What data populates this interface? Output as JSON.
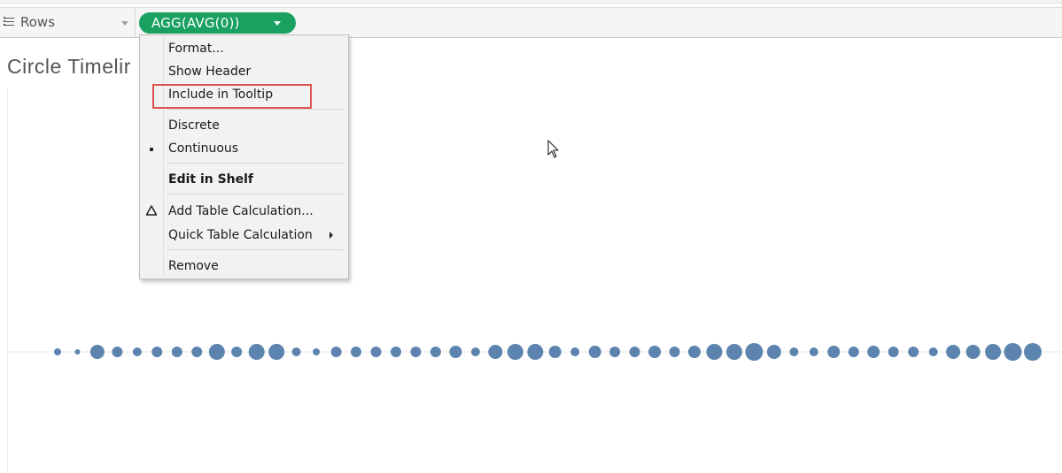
{
  "shelf": {
    "label": "Rows",
    "rows_icon": "list-icon",
    "dropdown_icon": "chevron-down-icon"
  },
  "pill": {
    "label": "AGG(AVG(0))",
    "color": "#1aa162",
    "dropdown_icon": "chevron-down-icon"
  },
  "view": {
    "title": "Circle Timelir"
  },
  "menu": {
    "items": [
      {
        "label": "Format..."
      },
      {
        "label": "Show Header"
      },
      {
        "label": "Include in Tooltip",
        "highlighted": true
      },
      {
        "label": "Discrete"
      },
      {
        "label": "Continuous",
        "selected": true
      },
      {
        "label": "Edit in Shelf",
        "bold": true
      },
      {
        "label": "Add Table Calculation...",
        "icon": "delta-icon"
      },
      {
        "label": "Quick Table Calculation",
        "submenu": true
      },
      {
        "label": "Remove"
      }
    ]
  },
  "colors": {
    "highlight_box": "#e05252",
    "circle_fill": "#4e79a7"
  },
  "chart_data": {
    "type": "scatter",
    "series": [
      {
        "x": [
          1,
          2,
          3,
          4,
          5,
          6,
          7,
          8,
          9,
          10,
          11,
          12,
          13,
          14,
          15,
          16,
          17,
          18,
          19,
          20,
          21,
          22,
          23,
          24,
          25,
          26,
          27,
          28,
          29,
          30,
          31,
          32,
          33,
          34,
          35,
          36,
          37,
          38,
          39,
          40,
          41,
          42,
          43,
          44,
          45,
          46,
          47,
          48,
          49,
          50
        ],
        "y": [
          0,
          0,
          0,
          0,
          0,
          0,
          0,
          0,
          0,
          0,
          0,
          0,
          0,
          0,
          0,
          0,
          0,
          0,
          0,
          0,
          0,
          0,
          0,
          0,
          0,
          0,
          0,
          0,
          0,
          0,
          0,
          0,
          0,
          0,
          0,
          0,
          0,
          0,
          0,
          0,
          0,
          0,
          0,
          0,
          0,
          0,
          0,
          0,
          0,
          0
        ],
        "size": [
          2,
          1,
          6,
          4,
          3,
          4,
          4,
          4,
          7,
          4,
          7,
          7,
          3,
          2,
          4,
          4,
          4,
          4,
          4,
          4,
          5,
          3,
          6,
          7,
          7,
          5,
          3,
          5,
          4,
          4,
          5,
          4,
          5,
          7,
          7,
          8,
          6,
          3,
          3,
          5,
          4,
          5,
          4,
          4,
          3,
          6,
          6,
          7,
          8,
          8
        ]
      }
    ],
    "ylim": [
      0,
      0
    ],
    "grid": false
  }
}
